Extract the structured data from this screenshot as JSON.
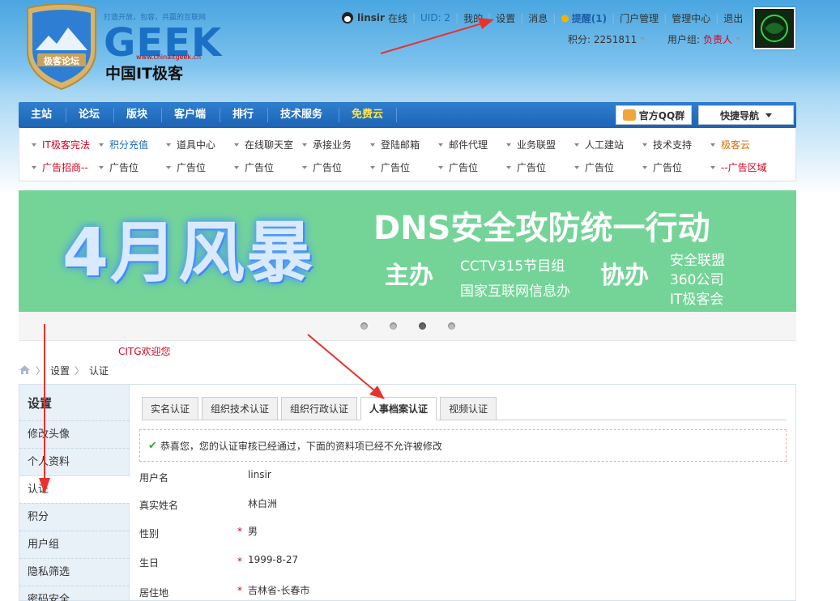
{
  "header": {
    "slogan": "打造开放，包容，共赢的互联网",
    "shield_text": "极客论坛",
    "logo_geek": "GEEK",
    "logo_url": "www.chinaitgeek.cn",
    "logo_cn": "中国IT极客",
    "username": "linsir",
    "online": "在线",
    "uid": "UID: 2",
    "links": [
      "我的",
      "设置",
      "消息"
    ],
    "remind": "提醒(1)",
    "links2": [
      "门户管理",
      "管理中心",
      "退出"
    ],
    "points": "积分: 2251811",
    "group_label": "用户组:",
    "group_value": "负责人"
  },
  "nav": {
    "items": [
      "主站",
      "论坛",
      "版块",
      "客户端",
      "排行",
      "技术服务",
      "免费云"
    ],
    "qq_button": "官方QQ群",
    "quick_nav": "快捷导航"
  },
  "subnav": {
    "row1": [
      "IT极客完法",
      "积分充值",
      "道具中心",
      "在线聊天室",
      "承接业务",
      "登陆邮箱",
      "邮件代理",
      "业务联盟",
      "人工建站",
      "技术支持",
      "极客云"
    ],
    "row2": [
      "广告招商--",
      "广告位",
      "广告位",
      "广告位",
      "广告位",
      "广告位",
      "广告位",
      "广告位",
      "广告位",
      "广告位",
      "--广告区域"
    ]
  },
  "banner": {
    "big": "4月风暴",
    "title": "DNS安全攻防统一行动",
    "host_label": "主办",
    "host1": "CCTV315节目组",
    "host2": "国家互联网信息办",
    "co_label": "协办",
    "co1": "安全联盟",
    "co2": "360公司",
    "co3": "IT极客会"
  },
  "welcome": "CITG欢迎您",
  "breadcrumb": [
    "设置",
    "认证"
  ],
  "sidebar": {
    "title": "设置",
    "items": [
      "修改头像",
      "个人资料",
      "认证",
      "积分",
      "用户组",
      "隐私筛选",
      "密码安全"
    ]
  },
  "tabs": [
    "实名认证",
    "组织技术认证",
    "组织行政认证",
    "人事档案认证",
    "视频认证"
  ],
  "notice": "恭喜您，您的认证审核已经通过，下面的资料项已经不允许被修改",
  "fields": [
    {
      "label": "用户名",
      "value": "linsir"
    },
    {
      "label": "真实姓名",
      "value": "林白洲"
    },
    {
      "label": "性别",
      "value": "男"
    },
    {
      "label": "生日",
      "value": "1999-8-27"
    },
    {
      "label": "居住地",
      "value": "吉林省-长春市"
    }
  ],
  "required_mark": "*",
  "colors": {
    "nav_blue": "#1d63b3",
    "banner_green": "#74d498",
    "accent_red": "#d6001c",
    "annotation": "#e8322b"
  }
}
